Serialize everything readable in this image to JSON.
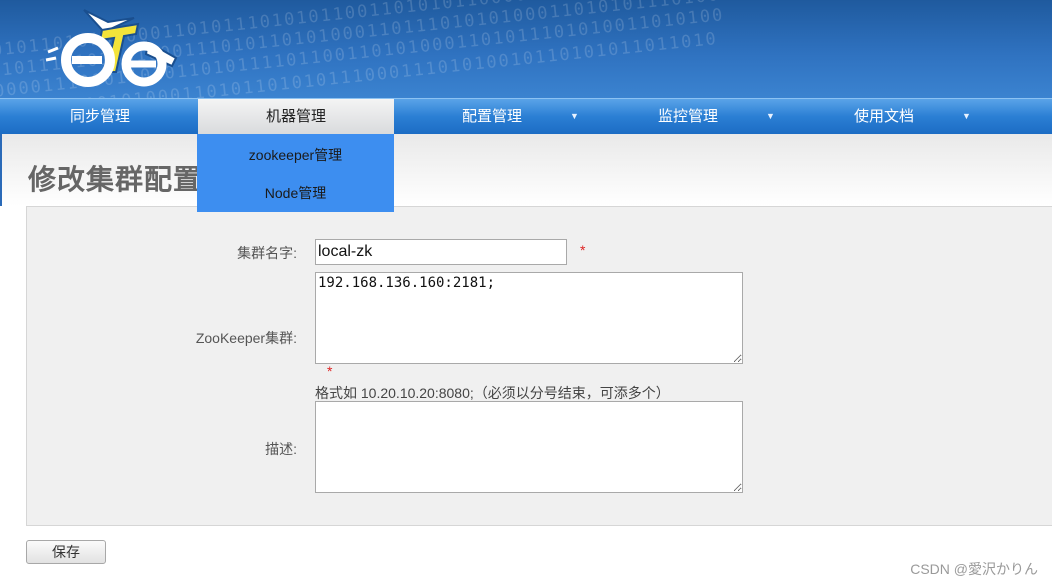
{
  "nav": {
    "items": [
      {
        "label": "同步管理"
      },
      {
        "label": "机器管理"
      },
      {
        "label": "配置管理"
      },
      {
        "label": "监控管理"
      },
      {
        "label": "使用文档"
      }
    ],
    "dropdown": [
      {
        "label": "zookeeper管理"
      },
      {
        "label": "Node管理"
      }
    ]
  },
  "page": {
    "title": "修改集群配置"
  },
  "form": {
    "cluster_name_label": "集群名字:",
    "cluster_name_value": "local-zk",
    "zk_cluster_label": "ZooKeeper集群:",
    "zk_cluster_value": "192.168.136.160:2181;",
    "zk_hint": "格式如 10.20.10.20:8080;（必须以分号结束，可添多个）",
    "desc_label": "描述:",
    "desc_value": "",
    "required_mark": "*",
    "save_label": "保存"
  },
  "watermark": "CSDN @愛沢かりん",
  "colors": {
    "nav": "#2b7fd4",
    "dropdown": "#3d8ef0",
    "required": "#dd2222"
  }
}
